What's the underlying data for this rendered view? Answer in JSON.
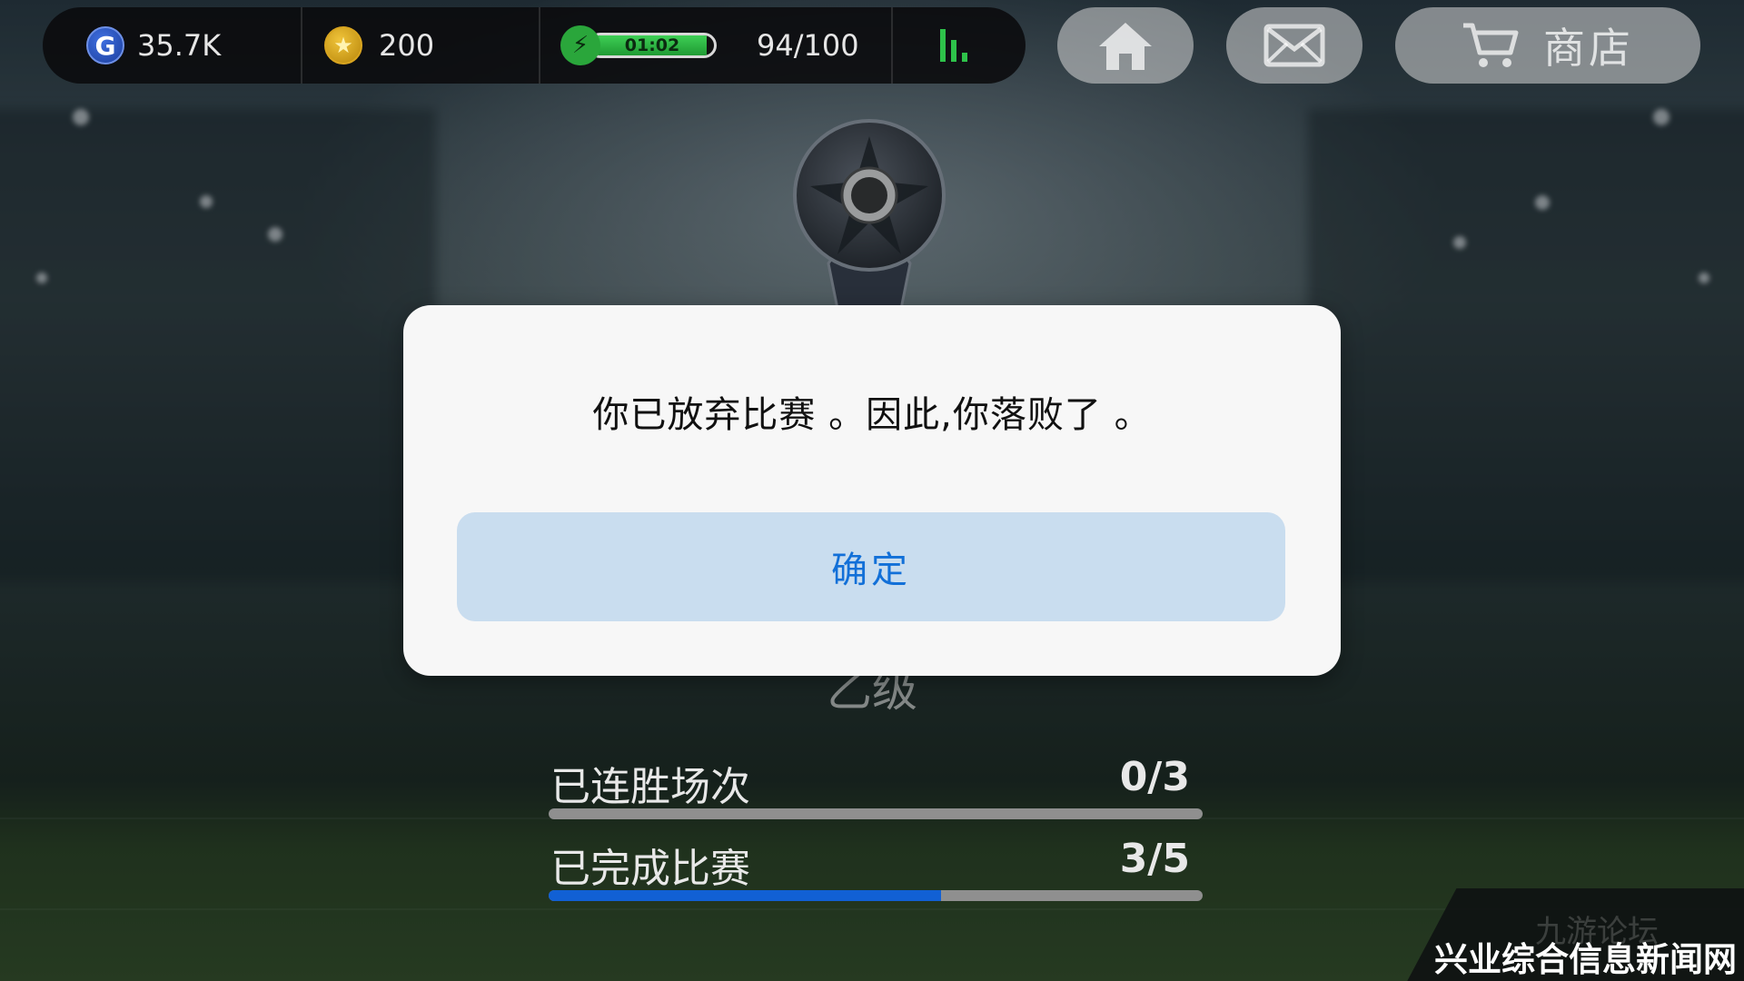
{
  "hud": {
    "gp_icon_letter": "G",
    "gp_amount": "35.7K",
    "coin_icon": "star-coin-icon",
    "coins_amount": "200",
    "energy_icon": "lightning-icon",
    "energy_timer": "01:02",
    "energy_level": 0.94,
    "energy_count": "94/100",
    "stats_icon": "bar-chart-icon"
  },
  "nav": {
    "home_icon": "home-icon",
    "mail_icon": "mail-icon",
    "shop_icon": "cart-icon",
    "shop_label": "商店"
  },
  "colors": {
    "accent_green": "#2ec24a",
    "button_bg": "#c9ddef",
    "button_text": "#1270d8",
    "progress_blue": "#1160d4"
  },
  "background": {
    "division_label": "乙级",
    "progress": [
      {
        "label": "已连胜场次",
        "value": "0/3",
        "fraction": 0.0
      },
      {
        "label": "已完成比赛",
        "value": "3/5",
        "fraction": 0.6
      }
    ]
  },
  "dialog": {
    "message": "你已放弃比赛 。因此,你落败了 。",
    "confirm_label": "确定"
  },
  "watermark": {
    "faint": "九游论坛",
    "text": "兴业综合信息新闻网"
  }
}
